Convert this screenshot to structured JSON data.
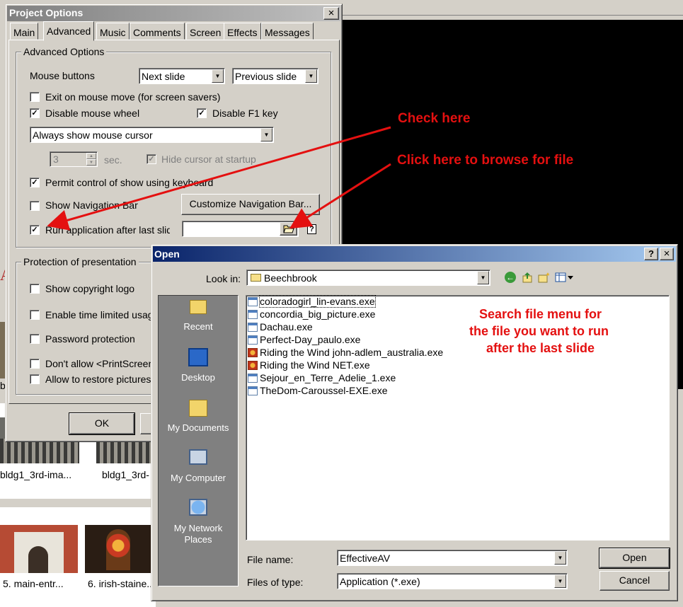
{
  "background": {
    "thumb_labels": [
      "bldg1_3rd-ima...",
      "bldg1_3rd-",
      "5. main-entr...",
      "6. irish-staine..."
    ],
    "left_letter_a": "A",
    "left_letter_b": "b"
  },
  "project_options": {
    "title": "Project Options",
    "close": "×",
    "tabs": [
      "Main",
      "Advanced",
      "Music",
      "Comments",
      "Screen",
      "Effects",
      "Messages"
    ],
    "advanced_group_label": "Advanced Options",
    "mouse_buttons_label": "Mouse buttons",
    "mouse_left_value": "Next slide",
    "mouse_right_value": "Previous slide",
    "exit_on_mouse_move": "Exit on mouse move (for screen savers)",
    "disable_mouse_wheel": "Disable mouse wheel",
    "disable_f1": "Disable F1 key",
    "cursor_mode_value": "Always show mouse cursor",
    "sec_value": "3",
    "sec_label": "sec.",
    "hide_cursor_label": "Hide cursor at startup",
    "permit_keyboard": "Permit control of show using keyboard",
    "show_nav_bar": "Show Navigation Bar",
    "customize_nav_button": "Customize Navigation Bar...",
    "run_app_label": "Run application after last slide",
    "run_app_value": "",
    "help_icon": "?",
    "protection_group_label": "Protection of presentation",
    "show_copyright": "Show copyright logo",
    "time_limited": "Enable time limited usage",
    "password": "Password protection",
    "dont_allow_print": "Don't allow <PrintScreen",
    "allow_restore": "Allow to restore pictures",
    "ok_button": "OK",
    "checks": {
      "exit_on_mouse_move": false,
      "disable_mouse_wheel": true,
      "disable_f1": true,
      "hide_cursor": true,
      "permit_keyboard": true,
      "show_nav_bar": false,
      "run_app": true,
      "show_copyright": false,
      "time_limited": false,
      "password": false,
      "dont_allow_print": false,
      "allow_restore": false
    }
  },
  "open_dialog": {
    "title": "Open",
    "help": "?",
    "close": "×",
    "look_in_label": "Look in:",
    "look_in_value": "Beechbrook",
    "places": [
      "Recent",
      "Desktop",
      "My Documents",
      "My Computer",
      "My Network Places"
    ],
    "files": [
      {
        "name": "coloradogirl_lin-evans.exe",
        "icon": "exe-icon"
      },
      {
        "name": "concordia_big_picture.exe",
        "icon": "exe-icon"
      },
      {
        "name": "Dachau.exe",
        "icon": "exe-icon"
      },
      {
        "name": "Perfect-Day_paulo.exe",
        "icon": "exe-icon"
      },
      {
        "name": "Riding the Wind john-adlem_australia.exe",
        "icon": "red-app-icon"
      },
      {
        "name": "Riding the Wind NET.exe",
        "icon": "red-app-icon"
      },
      {
        "name": "Sejour_en_Terre_Adelie_1.exe",
        "icon": "exe-icon"
      },
      {
        "name": "TheDom-Caroussel-EXE.exe",
        "icon": "exe-icon"
      }
    ],
    "file_name_label": "File name:",
    "file_name_value": "EffectiveAV",
    "files_of_type_label": "Files of type:",
    "files_of_type_value": "Application (*.exe)",
    "open_button": "Open",
    "cancel_button": "Cancel"
  },
  "annotations": {
    "check_here": "Check here",
    "browse": "Click here to browse for file",
    "search_line1": "Search file menu for",
    "search_line2": "the file you want to run",
    "search_line3": "after the last slide"
  },
  "colors": {
    "annotation_red": "#e41010",
    "title_gradient_start": "#0a246a",
    "title_gradient_end": "#a6caf0",
    "places_bar": "#808080"
  }
}
